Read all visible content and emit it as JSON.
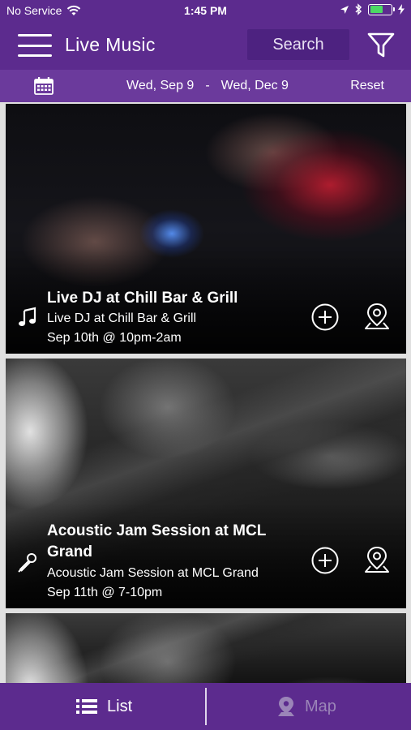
{
  "status_bar": {
    "carrier": "No Service",
    "time": "1:45 PM",
    "battery_level": 0.6,
    "battery_color": "#4cd964"
  },
  "nav": {
    "title": "Live Music",
    "search_label": "Search",
    "menu_icon": "hamburger-icon",
    "filter_icon": "funnel-icon",
    "background": "#5c2b8e"
  },
  "date_bar": {
    "start": "Wed, Sep 9",
    "separator": "-",
    "end": "Wed, Dec 9",
    "reset_label": "Reset",
    "icon": "calendar-icon"
  },
  "events": [
    {
      "title": "Live DJ at Chill Bar & Grill",
      "venue": "Live DJ at Chill Bar & Grill",
      "date": "Sep 10th @ 10pm-2am",
      "type_icon": "music-note-icon"
    },
    {
      "title": "Acoustic Jam Session at MCL Grand",
      "venue": "Acoustic Jam Session at MCL Grand",
      "date": "Sep 11th @ 7-10pm",
      "type_icon": "microphone-icon"
    }
  ],
  "tabs": {
    "list_label": "List",
    "map_label": "Map",
    "active": "List"
  }
}
